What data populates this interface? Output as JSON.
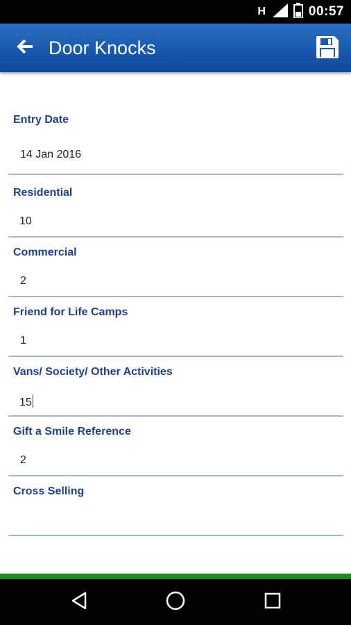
{
  "status_bar": {
    "time": "00:57",
    "network_letter": "H",
    "icons": [
      "signal-icon",
      "battery-icon"
    ]
  },
  "app_bar": {
    "title": "Door Knocks",
    "back_icon": "arrow-left-icon",
    "save_icon": "floppy-disk-icon"
  },
  "fields": [
    {
      "label": "Entry Date",
      "value": "14 Jan 2016"
    },
    {
      "label": "Residential",
      "value": "10"
    },
    {
      "label": "Commercial",
      "value": "2"
    },
    {
      "label": "Friend for Life Camps",
      "value": "1"
    },
    {
      "label": "Vans/ Society/ Other Activities",
      "value": "15"
    },
    {
      "label": "Gift a Smile Reference",
      "value": "2"
    },
    {
      "label": "Cross Selling",
      "value": ""
    }
  ],
  "nav_bar": {
    "icons": [
      "back-triangle-icon",
      "home-circle-icon",
      "recents-square-icon"
    ]
  },
  "colors": {
    "app_bar": "#1a5bb0",
    "label": "#1f3f96",
    "divider": "#a7b4cf",
    "bottom_accent": "#1f8a1f"
  }
}
